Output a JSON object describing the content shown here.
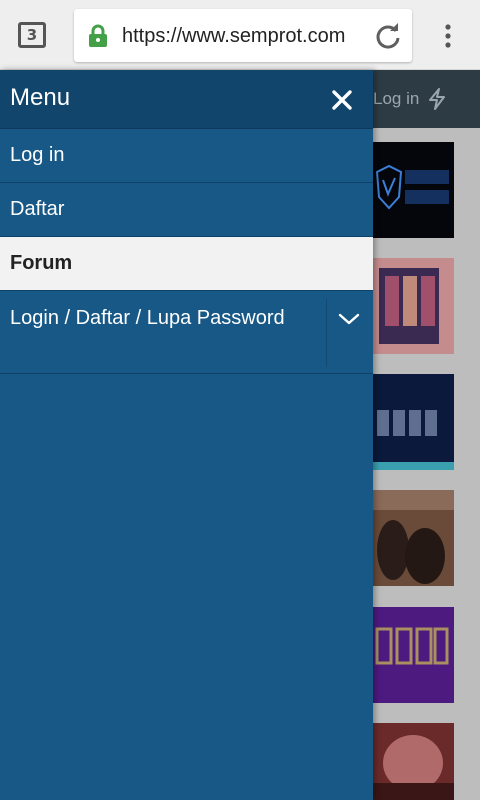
{
  "browser": {
    "tab_count": "3",
    "url": "https://www.semprot.com"
  },
  "page": {
    "header_login": "Log in"
  },
  "drawer": {
    "title": "Menu",
    "items": [
      {
        "label": "Log in"
      },
      {
        "label": "Daftar"
      },
      {
        "label": "Forum"
      },
      {
        "label": "Login / Daftar / Lupa Password"
      }
    ]
  },
  "colors": {
    "drawer_bg": "#185886",
    "drawer_header": "#11456b",
    "active_item_bg": "#f2f2f2",
    "lock_green": "#43a047"
  },
  "icons": [
    "tab-switcher-icon",
    "lock-icon",
    "reload-icon",
    "overflow-menu-icon",
    "flash-icon",
    "close-icon",
    "chevron-down-icon"
  ]
}
